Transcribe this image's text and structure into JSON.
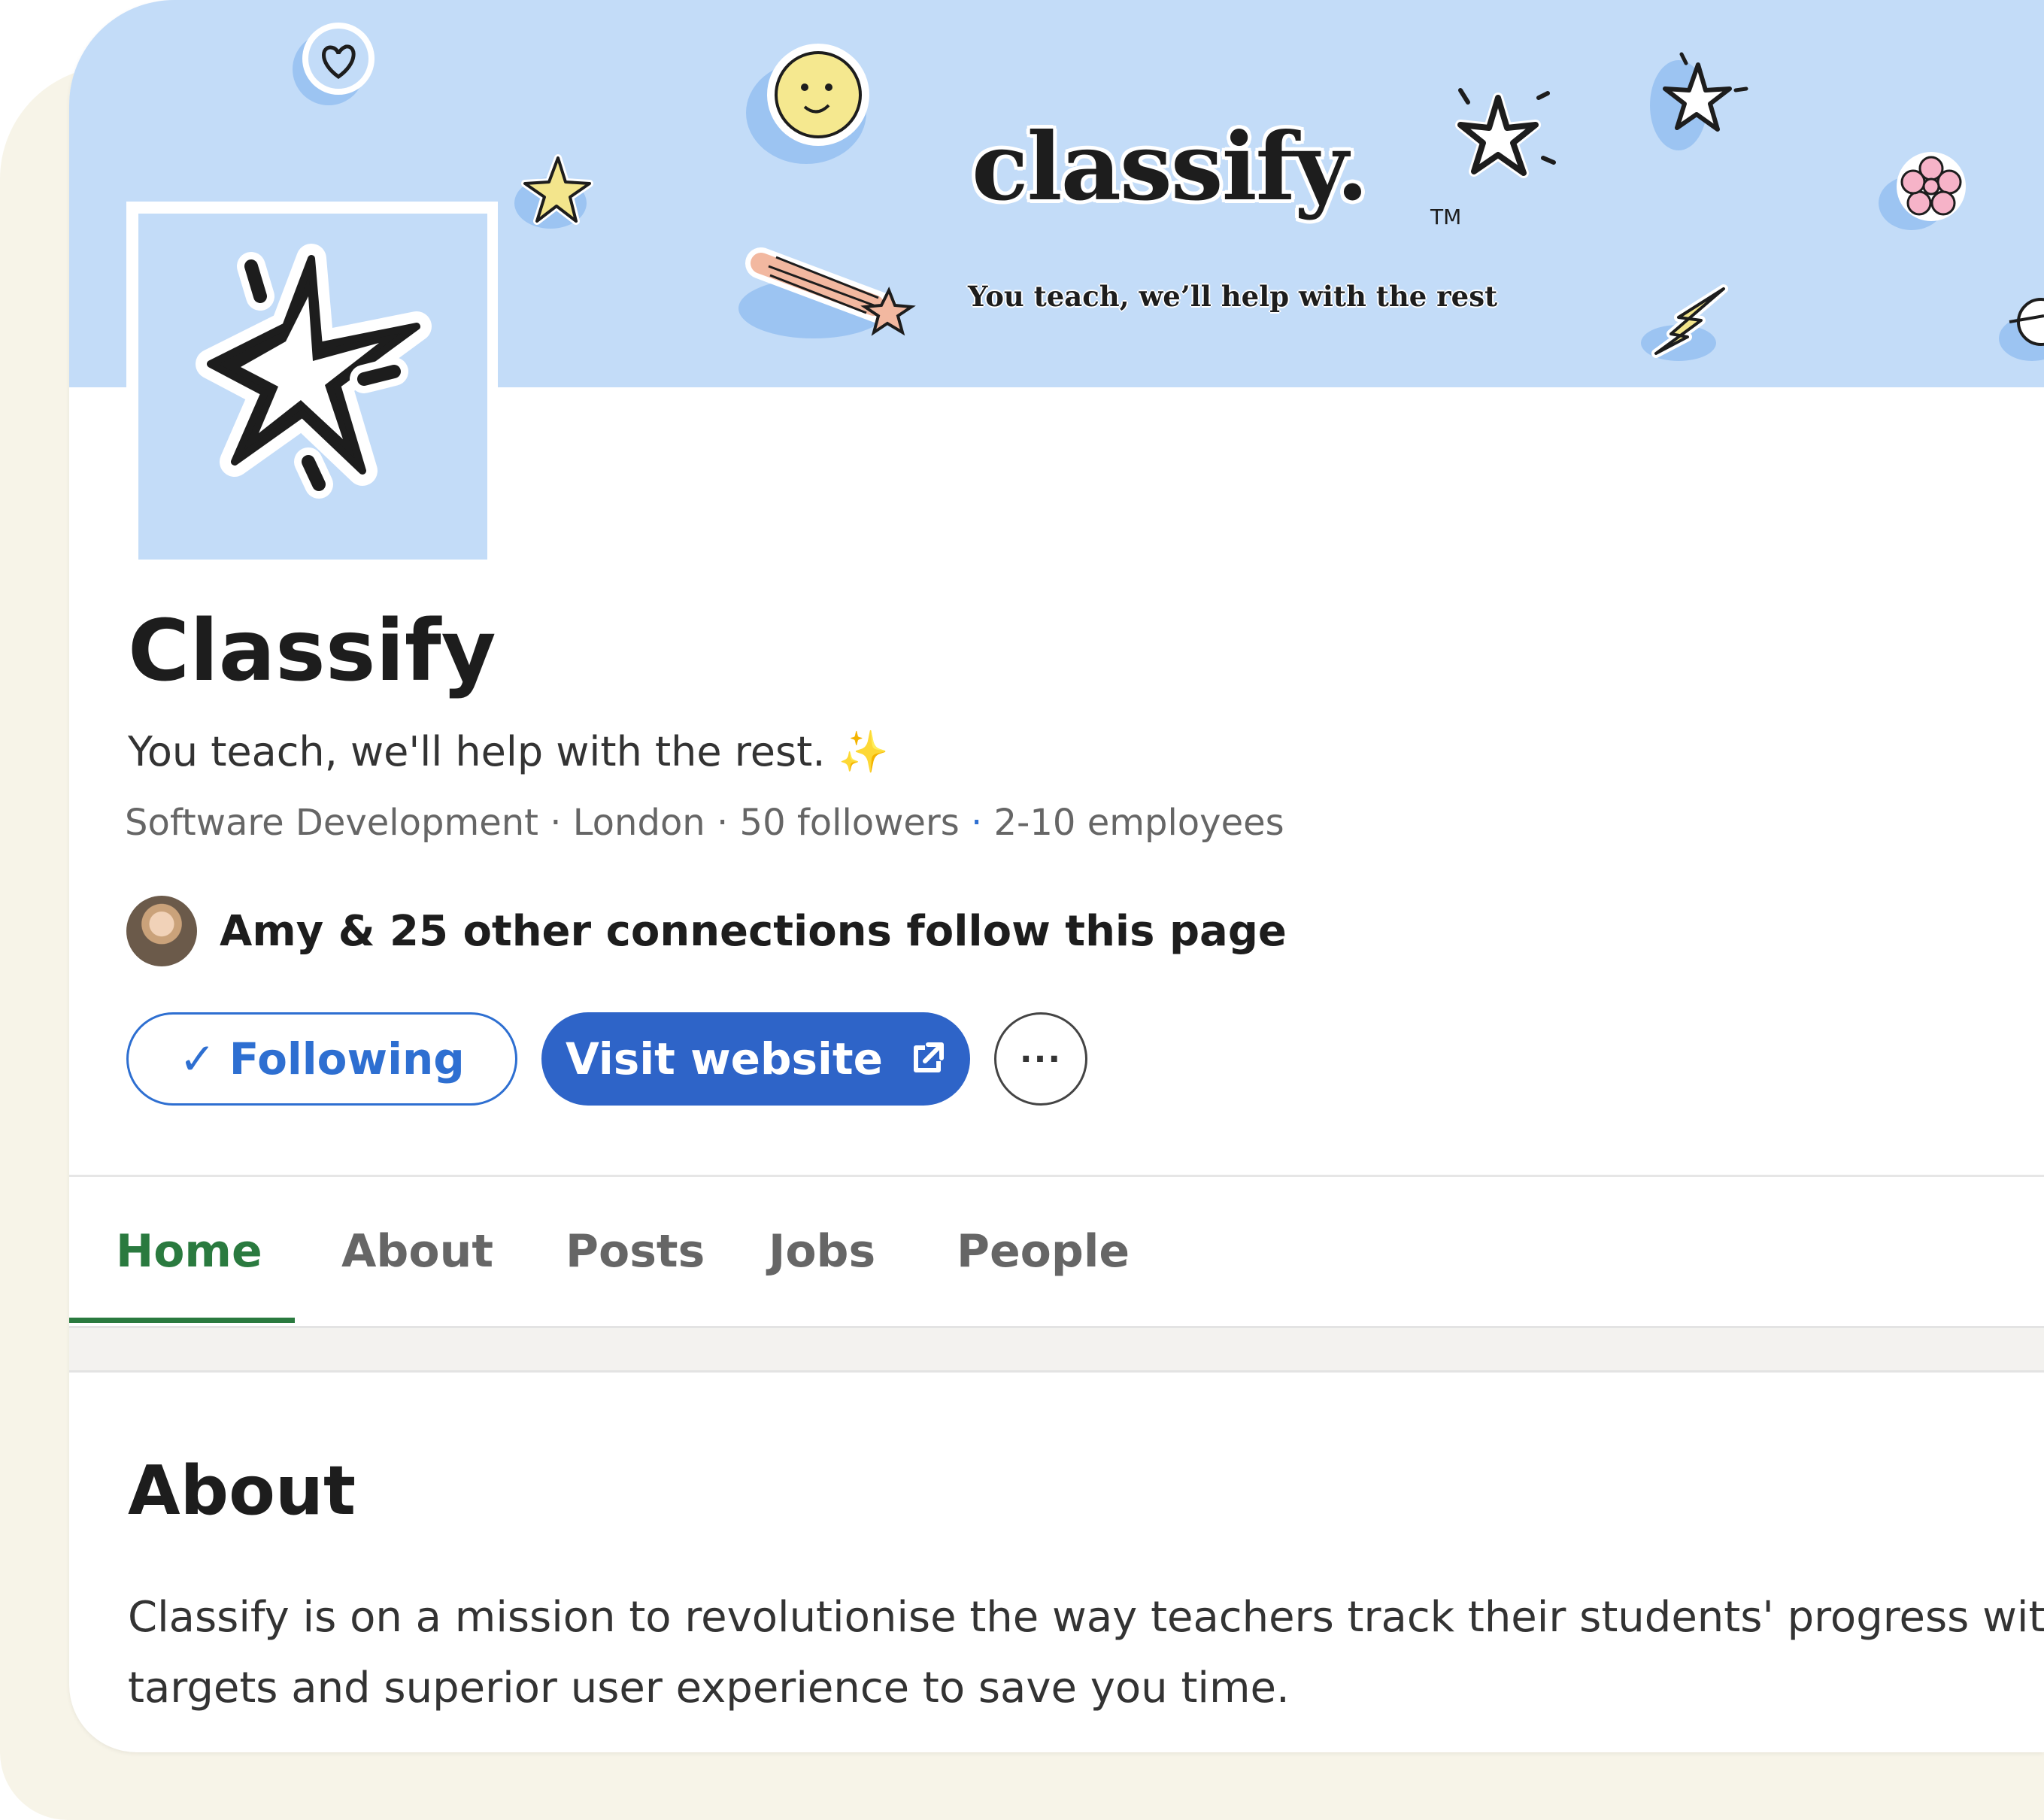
{
  "banner": {
    "wordmark": "classify.",
    "trademark": "TM",
    "tagline": "You teach, we’ll help with the rest"
  },
  "company": {
    "name": "Classify",
    "tagline": "You teach, we'll help with the rest.",
    "tagline_emoji": "✨",
    "industry": "Software Development",
    "location": "London",
    "followers": "50 followers",
    "employees": "2-10 employees",
    "separator": "·"
  },
  "connections": {
    "text": "Amy & 25 other connections follow this page"
  },
  "actions": {
    "following_label": "Following",
    "following_icon": "✓",
    "visit_label": "Visit website",
    "more_label": "···"
  },
  "tabs": [
    {
      "label": "Home",
      "active": true
    },
    {
      "label": "About",
      "active": false
    },
    {
      "label": "Posts",
      "active": false
    },
    {
      "label": "Jobs",
      "active": false
    },
    {
      "label": "People",
      "active": false
    }
  ],
  "about": {
    "heading": "About",
    "line1": "Classify is on a mission to revolutionise the way teachers track their students' progress with m",
    "line2": "targets and superior user experience to save you time."
  },
  "colors": {
    "banner_bg": "#c3dcf8",
    "primary_blue": "#2e64c8",
    "active_tab_green": "#2a7a3f",
    "outer_cream": "#f7f4e8"
  }
}
